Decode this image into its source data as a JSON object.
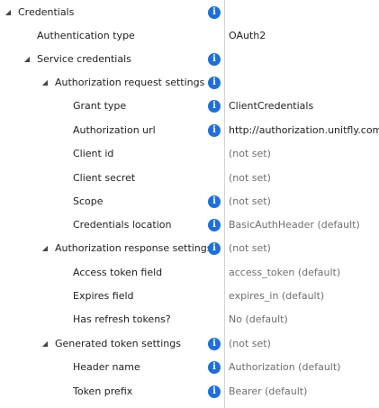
{
  "glyphs": {
    "expanded": "◢",
    "info": "i"
  },
  "properties": [
    {
      "name": "Credentials",
      "value": ""
    },
    {
      "name": "Authentication type",
      "value": "OAuth2"
    },
    {
      "name": "Service credentials",
      "value": ""
    },
    {
      "name": "Authorization request settings",
      "value": ""
    },
    {
      "name": "Grant type",
      "value": "ClientCredentials"
    },
    {
      "name": "Authorization url",
      "value": "http://authorization.unitfly.com"
    },
    {
      "name": "Client id",
      "value": "(not set)"
    },
    {
      "name": "Client secret",
      "value": "(not set)"
    },
    {
      "name": "Scope",
      "value": "(not set)"
    },
    {
      "name": "Credentials location",
      "value": "BasicAuthHeader (default)"
    },
    {
      "name": "Authorization response settings",
      "value": "(not set)"
    },
    {
      "name": "Access token field",
      "value": "access_token (default)"
    },
    {
      "name": "Expires field",
      "value": "expires_in (default)"
    },
    {
      "name": "Has refresh tokens?",
      "value": "No (default)"
    },
    {
      "name": "Generated token settings",
      "value": "(not set)"
    },
    {
      "name": "Header name",
      "value": "Authorization (default)"
    },
    {
      "name": "Token prefix",
      "value": "Bearer (default)"
    }
  ]
}
